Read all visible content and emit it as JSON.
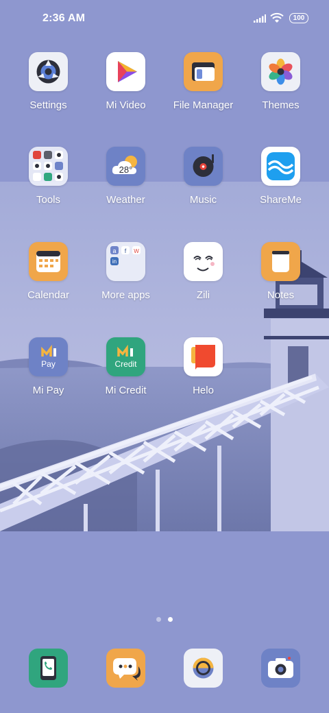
{
  "status": {
    "time": "2:36 AM",
    "battery": "100",
    "icons": [
      "signal-icon",
      "wifi-icon",
      "battery-icon"
    ]
  },
  "apps": [
    {
      "label": "Settings"
    },
    {
      "label": "Mi Video"
    },
    {
      "label": "File Manager"
    },
    {
      "label": "Themes"
    },
    {
      "label": "Tools"
    },
    {
      "label": "Weather",
      "temp": "28°"
    },
    {
      "label": "Music"
    },
    {
      "label": "ShareMe"
    },
    {
      "label": "Calendar"
    },
    {
      "label": "More apps"
    },
    {
      "label": "Zili"
    },
    {
      "label": "Notes"
    },
    {
      "label": "Mi Pay",
      "sub": "Pay"
    },
    {
      "label": "Mi Credit",
      "sub": "Credit"
    },
    {
      "label": "Helo"
    }
  ],
  "dock": [
    "phone-icon",
    "messaging-icon",
    "browser-icon",
    "camera-icon"
  ],
  "page_indicator": {
    "pages": 2,
    "current": 2
  },
  "colors": {
    "background": "#8e97cf",
    "orange": "#f0a64a",
    "blue_tile": "#6e82c6",
    "green": "#30a57e"
  }
}
